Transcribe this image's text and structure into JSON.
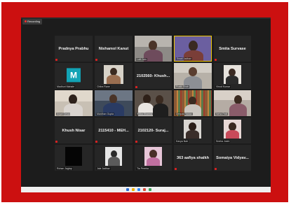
{
  "recording": {
    "label": "Recording"
  },
  "participants": {
    "p1": {
      "name": "Pradnya Prabhu"
    },
    "p2": {
      "name": "Nishamol Kanut"
    },
    "p3": {
      "caption": "Lalit Jain"
    },
    "p4": {
      "caption": "Swati Jadhav"
    },
    "p5": {
      "name": "Smita Survase"
    },
    "p6": {
      "initial": "M",
      "caption": "Madhuri Mahale"
    },
    "p7": {
      "caption": "Chitra Rane"
    },
    "p8": {
      "name": "2102560- Khush..."
    },
    "p9": {
      "caption": "Pratik Shah"
    },
    "p10": {
      "caption": "Vinod Kumar"
    },
    "p11": {
      "caption": "Anjali Desai"
    },
    "p12": {
      "caption": "Manthan Gupta"
    },
    "p13": {
      "caption": "Ritika Sharma"
    },
    "p14": {
      "caption": "Deepak Yadav"
    },
    "p15": {
      "caption": "Neha Patil"
    },
    "p16": {
      "name": "Khush Nisar"
    },
    "p17": {
      "name": "2115410 - MEH..."
    },
    "p18": {
      "name": "2102120- Suraj..."
    },
    "p19": {
      "caption": "Kavya Nair"
    },
    "p20": {
      "caption": "Sneha Joshi"
    },
    "p21": {
      "caption": "Rohan Jagtap"
    },
    "p22": {
      "caption": "Jaie Jadhav"
    },
    "p23": {
      "caption": "Tia Pereira"
    },
    "p24": {
      "name": "363 aafiya shaikh"
    },
    "p25": {
      "name": "Somaiya Vidyav..."
    }
  },
  "colors": {
    "frame": "#cc1010",
    "active_border": "#f0c800",
    "avatar_bg": "#12a3b5",
    "grid_bg": "#1c1c1c"
  }
}
